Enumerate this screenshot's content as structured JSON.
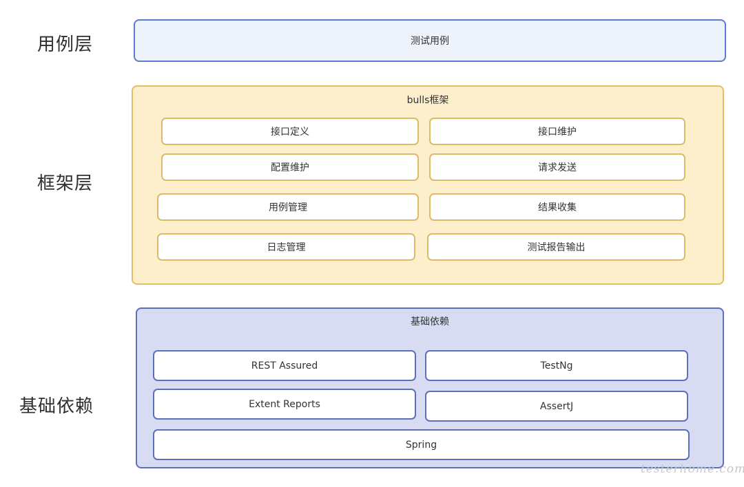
{
  "layers": {
    "usecase": {
      "label": "用例层",
      "content": "测试用例"
    },
    "framework": {
      "label": "框架层",
      "title": "bulls框架",
      "modules": [
        "接口定义",
        "接口维护",
        "配置维护",
        "请求发送",
        "用例管理",
        "结果收集",
        "日志管理",
        "测试报告输出"
      ]
    },
    "dependencies": {
      "label": "基础依赖",
      "title": "基础依赖",
      "items": [
        "REST Assured",
        "TestNg",
        "Extent Reports",
        "AssertJ",
        "Spring"
      ]
    }
  },
  "colors": {
    "usecase_fill": "#eef2fb",
    "usecase_border": "#5b7bd0",
    "framework_fill": "#fdefcc",
    "framework_border": "#e1bf62",
    "deps_fill": "#d7dcf2",
    "deps_border": "#5b6fba"
  },
  "watermark": "testerhome.com"
}
